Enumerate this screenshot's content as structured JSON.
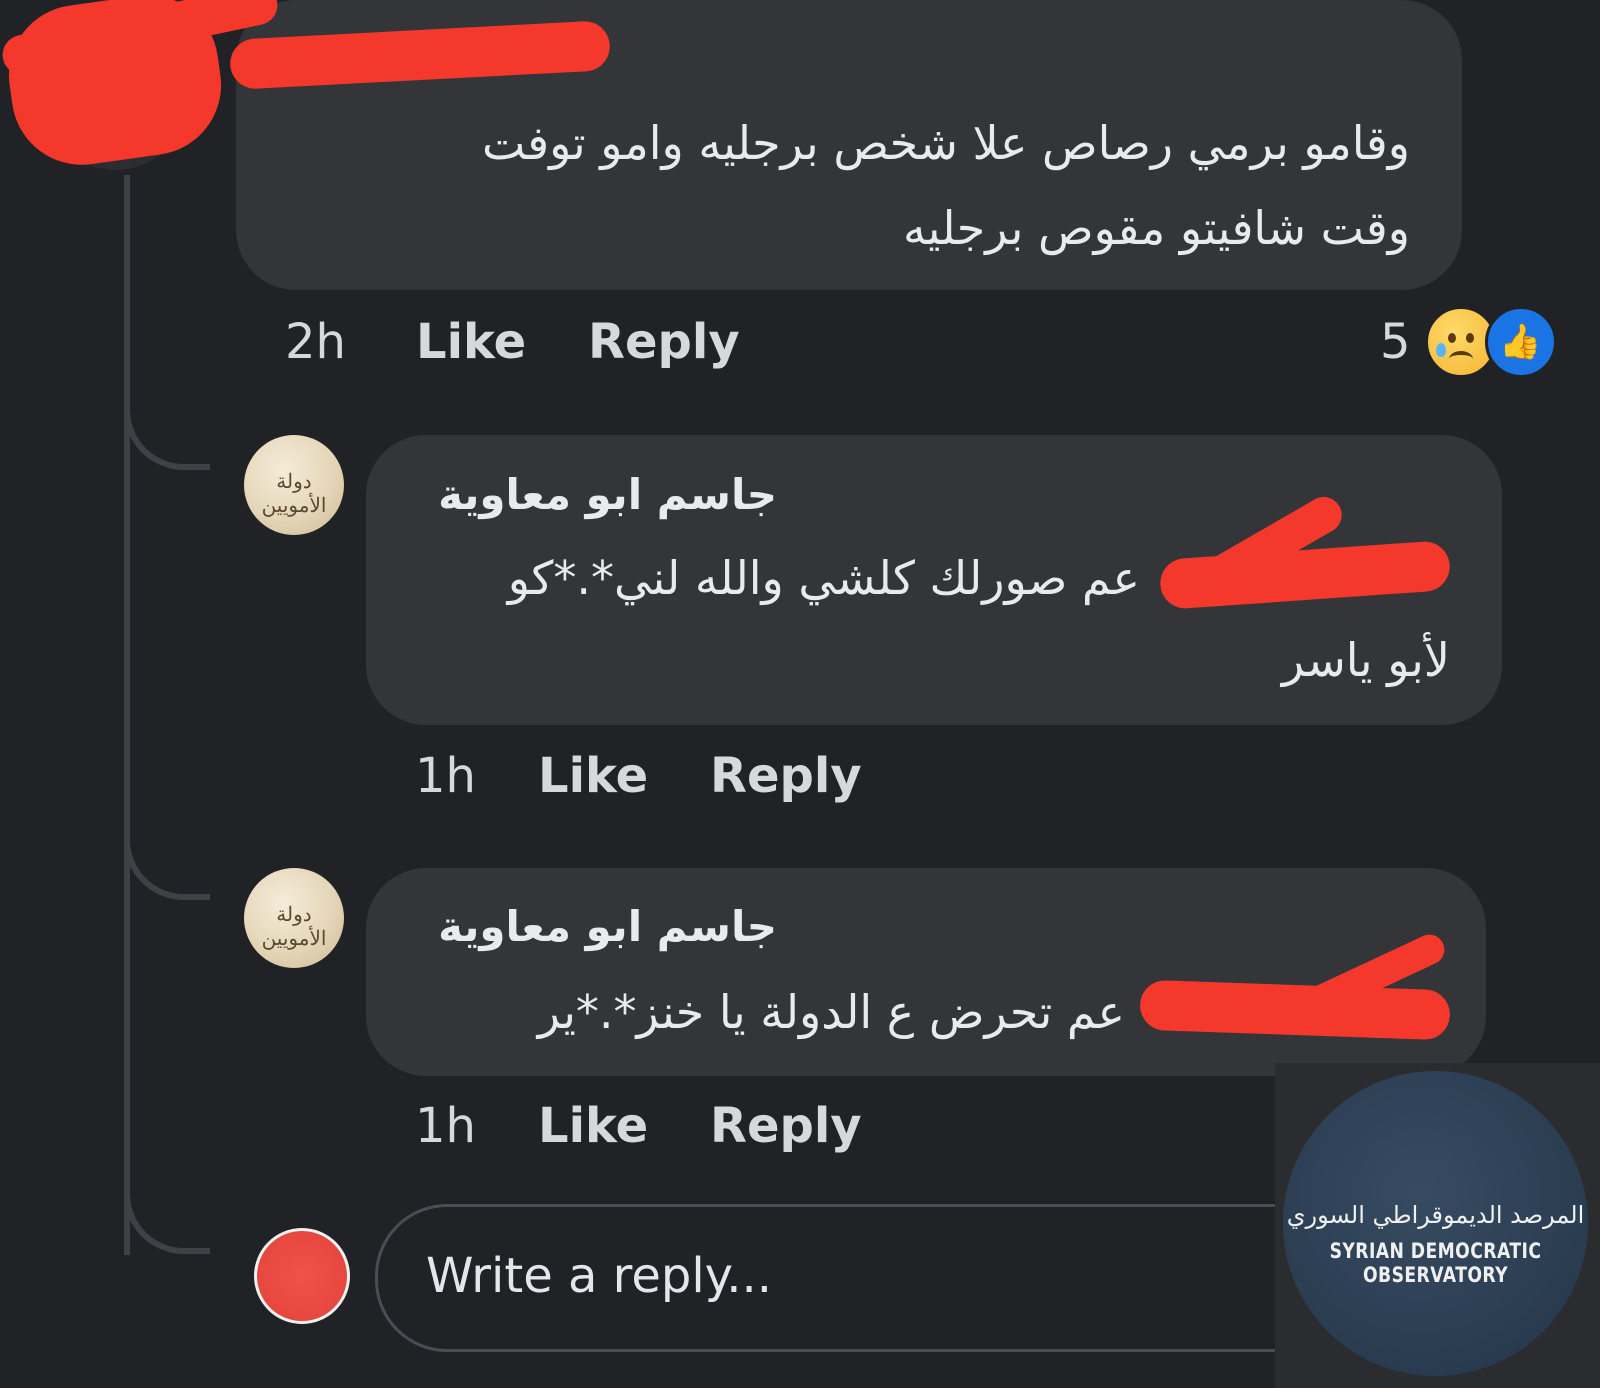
{
  "comments": [
    {
      "text_line1": "وقامو برمي رصاص علا شخص برجليه وامو توفت",
      "text_line2": "وقت شافيتو مقوص برجليه",
      "time": "2h",
      "like_label": "Like",
      "reply_label": "Reply",
      "reaction_count": "5",
      "reactions": [
        "sad-emoji",
        "like-emoji"
      ]
    },
    {
      "author": "جاسم ابو معاوية",
      "text_line1": "عم صورلك كلشي والله لني*.*كو",
      "text_line2": "لأبو ياسر",
      "time": "1h",
      "like_label": "Like",
      "reply_label": "Reply"
    },
    {
      "author": "جاسم ابو معاوية",
      "text_line1": "عم تحرض ع الدولة يا خنز*.*ير",
      "time": "1h",
      "like_label": "Like",
      "reply_label": "Reply"
    }
  ],
  "avatar_text": "دولة الأمويين",
  "reply_box": {
    "placeholder": "Write a reply..."
  },
  "watermark": {
    "arabic": "المرصد الديموقراطي السوري",
    "english": "SYRIAN DEMOCRATIC OBSERVATORY"
  },
  "colors": {
    "background": "#202225",
    "bubble": "#333538",
    "redaction": "#f4382b",
    "like_blue": "#1b74e4"
  }
}
